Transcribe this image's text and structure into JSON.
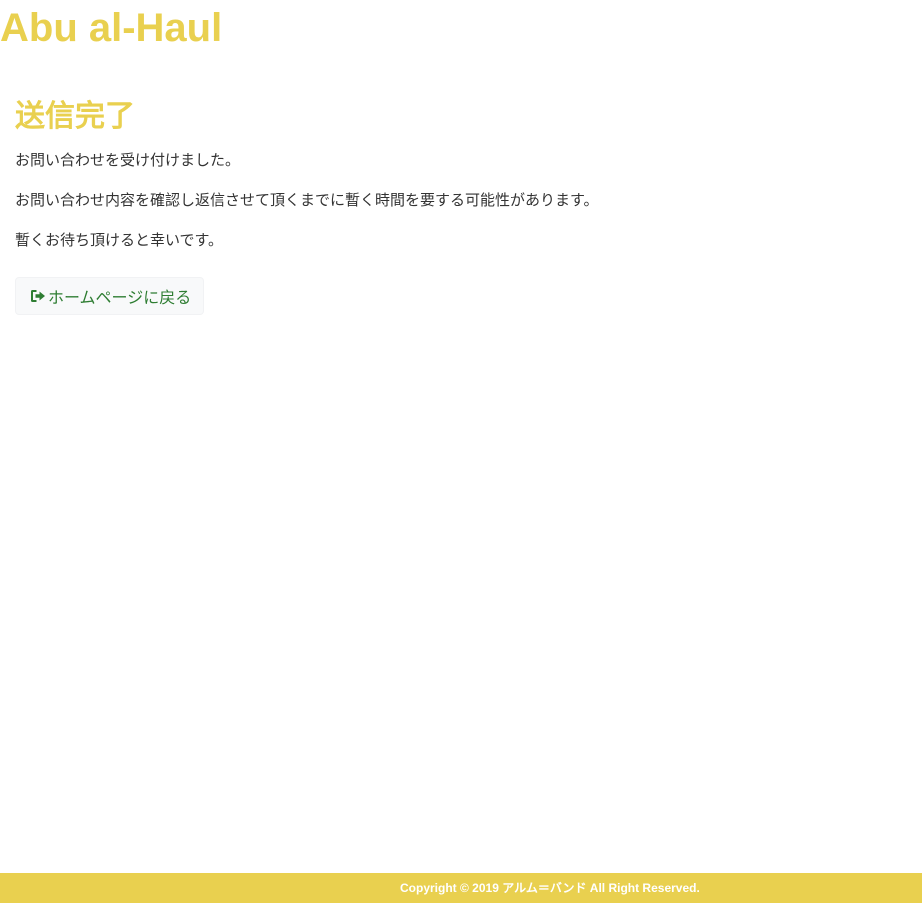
{
  "site": {
    "title": "Abu al-Haul"
  },
  "main": {
    "heading": "送信完了",
    "messages": [
      "お問い合わせを受け付けました。",
      "お問い合わせ内容を確認し返信させて頂くまでに暫く時間を要する可能性があります。",
      "暫くお待ち頂けると幸いです。"
    ],
    "home_button": {
      "label": "ホームページに戻る",
      "icon": "sign-out-icon"
    }
  },
  "footer": {
    "copyright": "Copyright © 2019 アルム＝バンド All Right Reserved."
  },
  "colors": {
    "accent": "#e9d04f",
    "button_text": "#2e7d32",
    "body_text": "#333333",
    "footer_text": "#ffffff"
  }
}
